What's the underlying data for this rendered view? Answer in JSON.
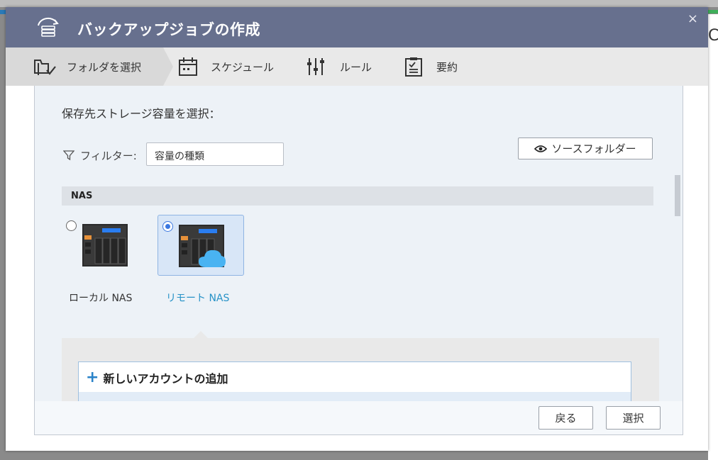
{
  "dialog": {
    "title": "バックアップジョブの作成",
    "close_glyph": "×",
    "title_icon": "backup-sync-icon"
  },
  "steps": [
    {
      "label": "フォルダを選択",
      "icon": "folder-select-icon",
      "active": true
    },
    {
      "label": "スケジュール",
      "icon": "calendar-icon",
      "active": false
    },
    {
      "label": "ルール",
      "icon": "sliders-icon",
      "active": false
    },
    {
      "label": "要約",
      "icon": "clipboard-icon",
      "active": false
    }
  ],
  "content": {
    "heading": "保存先ストレージ容量を選択：",
    "filter_label": "フィルター:",
    "filter_value": "容量の種類",
    "source_folder_button": "ソースフォルダー",
    "group_title": "NAS",
    "nas_options": [
      {
        "label": "ローカル NAS",
        "selected": false
      },
      {
        "label": "リモート NAS",
        "selected": true
      }
    ],
    "add_account_label": "新しいアカウントの追加"
  },
  "footer": {
    "back_label": "戻る",
    "select_label": "選択"
  },
  "colors": {
    "titlebar": "#67708e",
    "accent_blue": "#3b78e0",
    "remote_label": "#2792c7",
    "selected_card_bg": "#d8e6f7"
  }
}
